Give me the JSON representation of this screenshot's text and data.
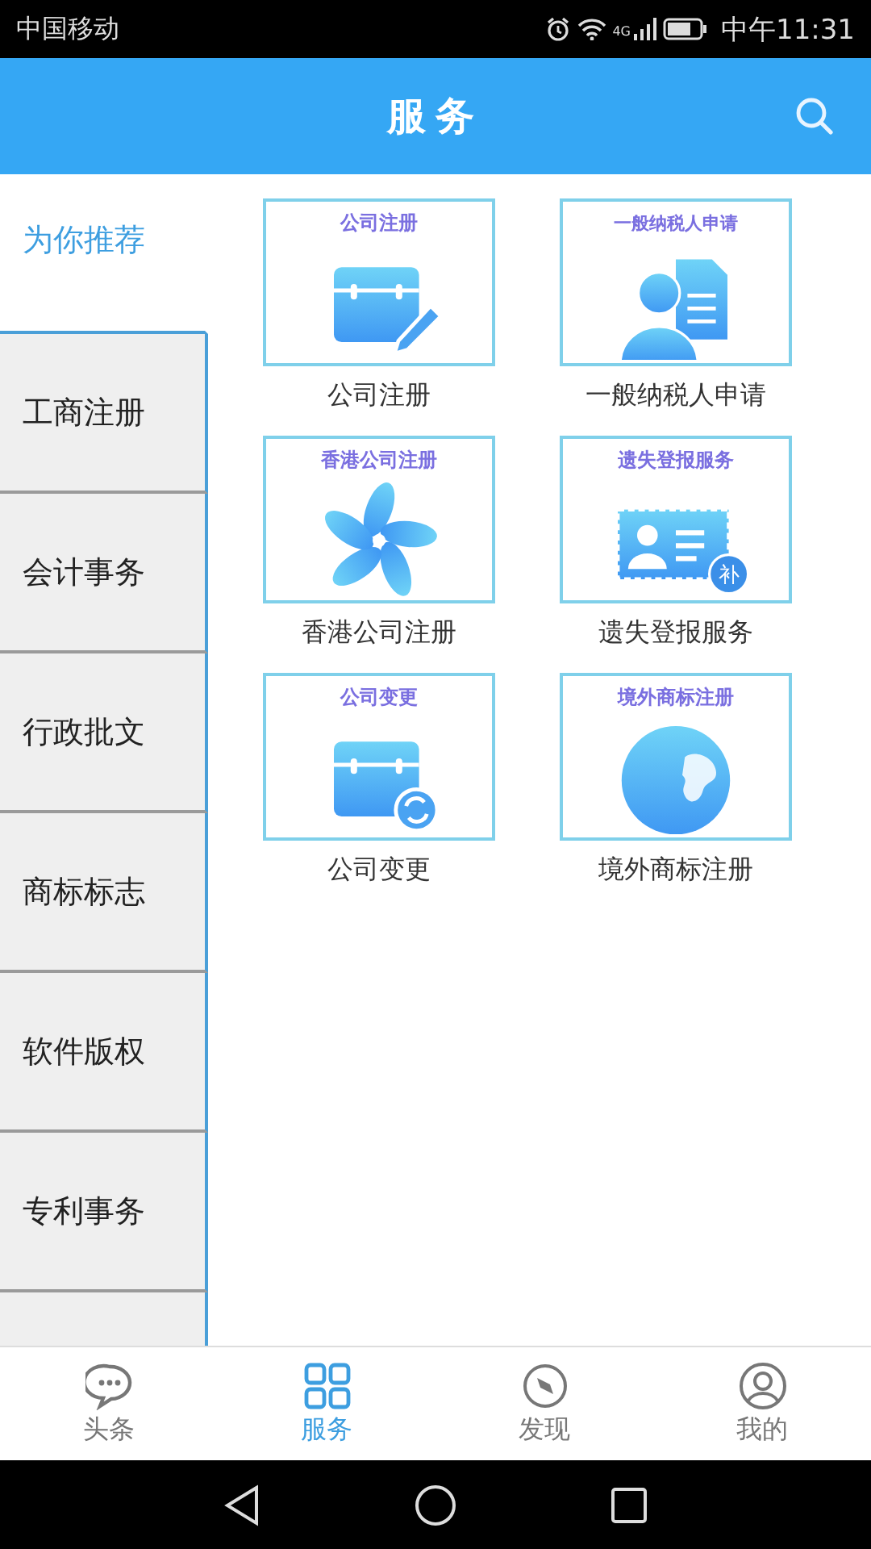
{
  "status_bar": {
    "carrier": "中国移动",
    "network": "4G",
    "time": "中午11:31"
  },
  "header": {
    "title": "服务"
  },
  "sidebar": {
    "items": [
      {
        "label": "为你推荐",
        "selected": true
      },
      {
        "label": "工商注册",
        "selected": false
      },
      {
        "label": "会计事务",
        "selected": false
      },
      {
        "label": "行政批文",
        "selected": false
      },
      {
        "label": "商标标志",
        "selected": false
      },
      {
        "label": "软件版权",
        "selected": false
      },
      {
        "label": "专利事务",
        "selected": false
      },
      {
        "selected": false
      }
    ]
  },
  "services": [
    {
      "kind": "briefcase-pen",
      "icon_text": "公司注册",
      "label": "公司注册"
    },
    {
      "kind": "person-doc",
      "icon_text": "一般纳税人申请",
      "label": "一般纳税人申请"
    },
    {
      "kind": "flower",
      "icon_text": "香港公司注册",
      "label": "香港公司注册"
    },
    {
      "kind": "id-card",
      "icon_text": "遗失登报服务",
      "badge": "补",
      "label": "遗失登报服务"
    },
    {
      "kind": "briefcase-sync",
      "icon_text": "公司变更",
      "label": "公司变更"
    },
    {
      "kind": "globe",
      "icon_text": "境外商标注册",
      "label": "境外商标注册"
    }
  ],
  "tab_bar": [
    {
      "kind": "chat",
      "label": "头条",
      "selected": false
    },
    {
      "kind": "grid",
      "label": "服务",
      "selected": true
    },
    {
      "kind": "compass",
      "label": "发现",
      "selected": false
    },
    {
      "kind": "person",
      "label": "我的",
      "selected": false
    }
  ]
}
